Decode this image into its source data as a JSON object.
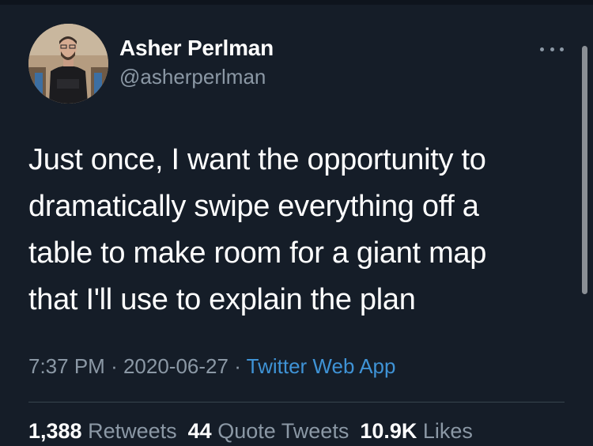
{
  "tweet": {
    "author_name": "Asher Perlman",
    "author_handle": "@asherperlman",
    "text_lines": [
      "Just once, I want the opportunity to",
      "dramatically swipe everything off a",
      "table to make room for a giant map",
      "that I'll use to explain the plan"
    ],
    "time": "7:37 PM",
    "date": "2020-06-27",
    "separator": "·",
    "source": "Twitter Web App",
    "stats": {
      "retweets_count": "1,388",
      "retweets_label": "Retweets",
      "quotes_count": "44",
      "quotes_label": "Quote Tweets",
      "likes_count": "10.9K",
      "likes_label": "Likes"
    }
  },
  "icons": {
    "more": "more-options-icon"
  },
  "colors": {
    "background": "#151d28",
    "text_primary": "#ffffff",
    "text_secondary": "#8b98a5",
    "link": "#3f93d6",
    "divider": "#38444d"
  }
}
